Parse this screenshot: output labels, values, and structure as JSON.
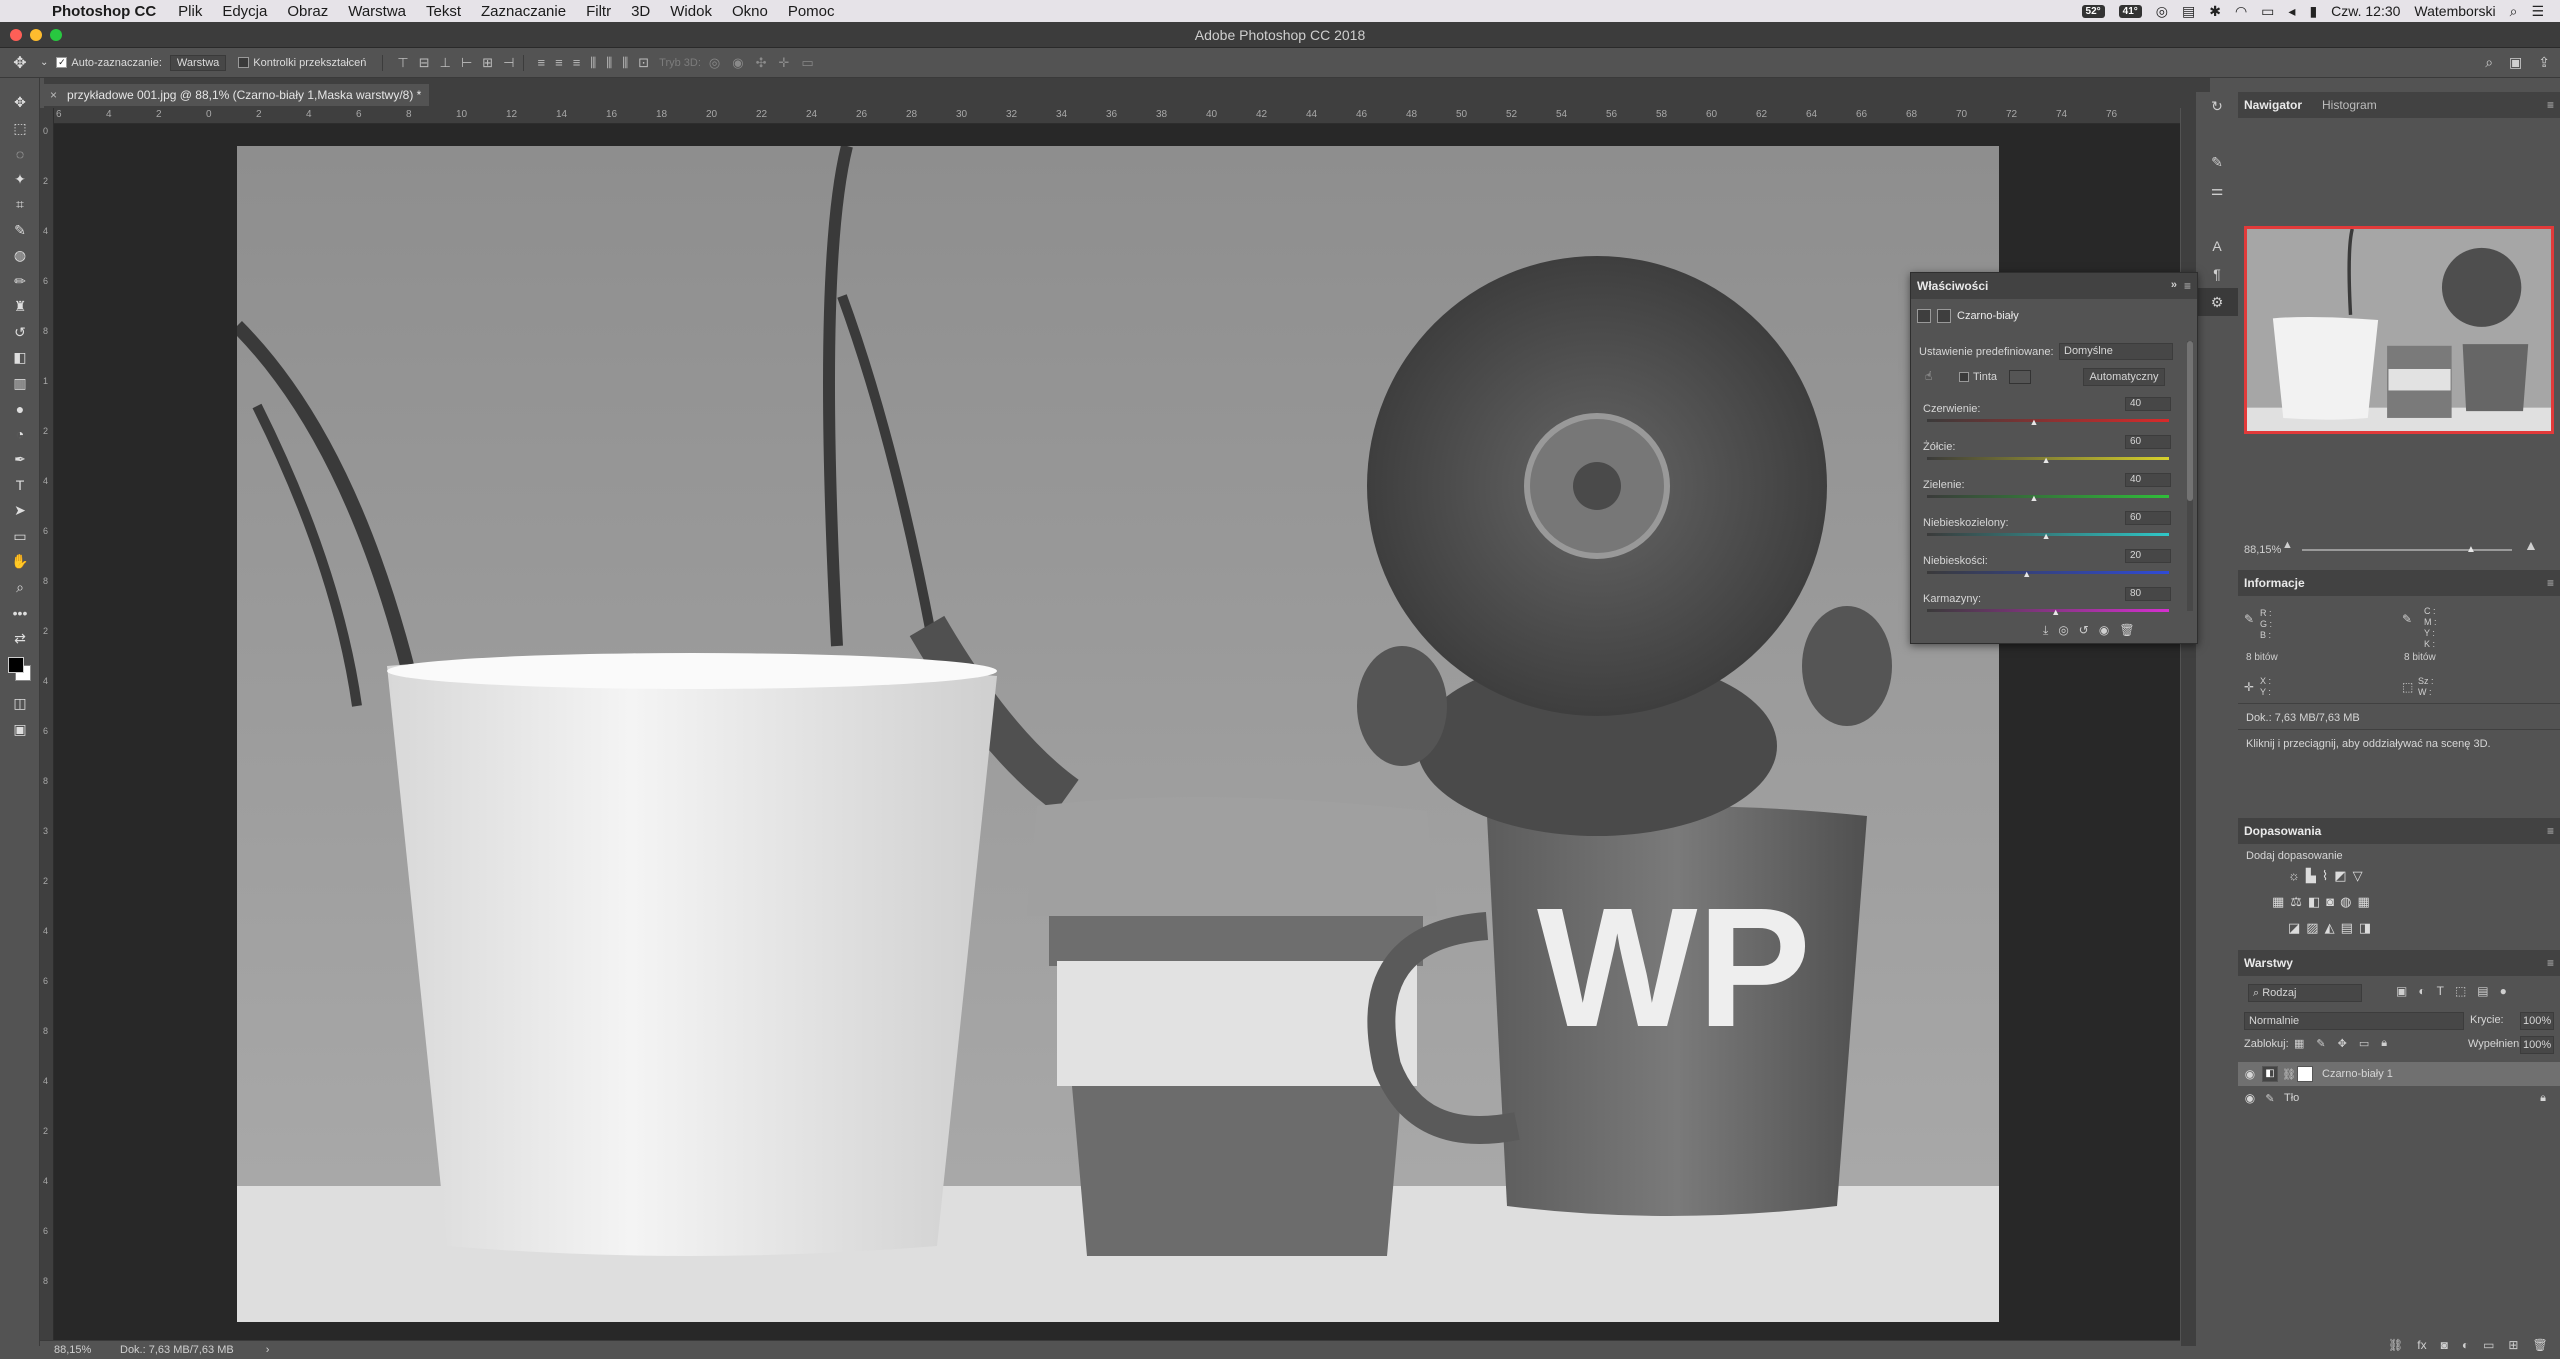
{
  "menubar": {
    "app_name": "Photoshop CC",
    "items": [
      "Plik",
      "Edycja",
      "Obraz",
      "Warstwa",
      "Tekst",
      "Zaznaczanie",
      "Filtr",
      "3D",
      "Widok",
      "Okno",
      "Pomoc"
    ],
    "status": {
      "temp1": "52°",
      "temp2": "41°",
      "clock": "Czw. 12:30",
      "user": "Watemborski"
    }
  },
  "window": {
    "title": "Adobe Photoshop CC 2018"
  },
  "options": {
    "auto_select_label": "Auto-zaznaczanie:",
    "auto_select_target": "Warstwa",
    "transform_controls_label": "Kontrolki przekształceń",
    "mode3d_label": "Tryb 3D:"
  },
  "document": {
    "tab_title": "przykładowe 001.jpg @ 88,1% (Czarno-biały 1,Maska warstwy/8) *"
  },
  "ruler": {
    "top_ticks": [
      "6",
      "4",
      "2",
      "0",
      "2",
      "4",
      "6",
      "8",
      "10",
      "12",
      "14",
      "16",
      "18",
      "20",
      "22",
      "24",
      "26",
      "28",
      "30",
      "32",
      "34",
      "36",
      "38",
      "40",
      "42",
      "44",
      "46",
      "48",
      "50",
      "52",
      "54",
      "56",
      "58",
      "60",
      "62",
      "64",
      "66",
      "68",
      "70",
      "72",
      "74",
      "76"
    ],
    "left_ticks": [
      "0",
      "2",
      "4",
      "6",
      "8",
      "1",
      "2",
      "4",
      "6",
      "8",
      "2",
      "4",
      "6",
      "8",
      "3",
      "2",
      "4",
      "6",
      "8",
      "4",
      "2",
      "4",
      "6",
      "8"
    ]
  },
  "statusbar": {
    "zoom": "88,15%",
    "doc": "Dok.: 7,63 MB/7,63 MB",
    "arrow": "›"
  },
  "navigator": {
    "tab_active": "Nawigator",
    "tab_other": "Histogram",
    "zoom": "88,15%",
    "zoom_level": 0.8
  },
  "info": {
    "title": "Informacje",
    "rgb_labels": [
      "R :",
      "G :",
      "B :"
    ],
    "cmyk_labels": [
      "C :",
      "M :",
      "Y :",
      "K :"
    ],
    "bits_left": "8 bitów",
    "bits_right": "8 bitów",
    "xy_labels": [
      "X :",
      "Y :"
    ],
    "size_labels": [
      "Sz :",
      "W :"
    ],
    "doc": "Dok.: 7,63 MB/7,63 MB",
    "help": "Kliknij i przeciągnij, aby oddziaływać na scenę 3D."
  },
  "adjustments": {
    "title": "Dopasowania",
    "subtitle": "Dodaj dopasowanie"
  },
  "layers": {
    "title": "Warstwy",
    "filter": "Rodzaj",
    "blend_mode": "Normalnie",
    "opacity_label": "Krycie:",
    "opacity_value": "100%",
    "lock_label": "Zablokuj:",
    "fill_label": "Wypełnienie:",
    "fill_value": "100%",
    "items": [
      {
        "name": "Czarno-biały 1",
        "selected": true
      },
      {
        "name": "Tło",
        "selected": false
      }
    ]
  },
  "properties": {
    "title": "Właściwości",
    "type": "Czarno-biały",
    "preset_label": "Ustawienie predefiniowane:",
    "preset_value": "Domyślne",
    "tint_label": "Tinta",
    "auto_button": "Automatyczny",
    "sliders": [
      {
        "label": "Czerwienie:",
        "value": "40",
        "position": 0.44,
        "color": "#d92a2a"
      },
      {
        "label": "Żółcie:",
        "value": "60",
        "position": 0.49,
        "color": "#d8d22b"
      },
      {
        "label": "Zielenie:",
        "value": "40",
        "position": 0.44,
        "color": "#2fbf3a"
      },
      {
        "label": "Niebieskozielony:",
        "value": "60",
        "position": 0.49,
        "color": "#2fc8c8"
      },
      {
        "label": "Niebieskości:",
        "value": "20",
        "position": 0.41,
        "color": "#2f4bd8"
      },
      {
        "label": "Karmazyny:",
        "value": "80",
        "position": 0.53,
        "color": "#d62fd0"
      }
    ]
  },
  "colors": {
    "accent_nav_border": "#e23a3a"
  }
}
